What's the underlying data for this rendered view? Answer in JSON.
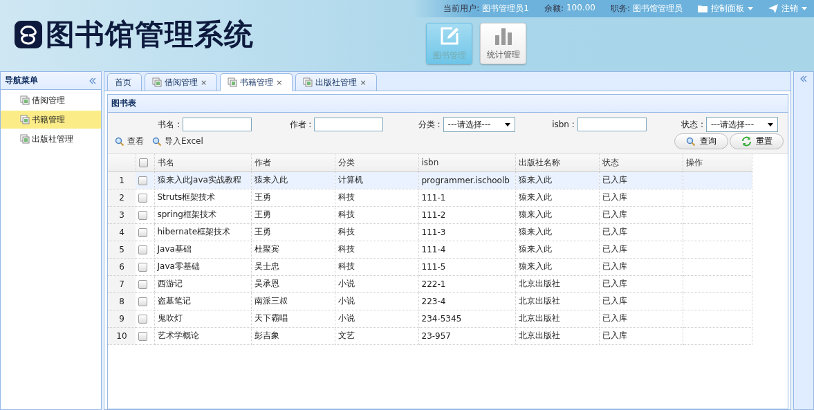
{
  "header": {
    "logo_text": "图书馆管理系统",
    "user_bar": [
      {
        "label": "当前用户:",
        "value": "图书管理员1"
      },
      {
        "label": "余额:",
        "value": "100.00"
      },
      {
        "label": "职务:",
        "value": "图书馆管理员"
      }
    ],
    "menus": [
      {
        "kind": "panel",
        "label": "控制面板"
      },
      {
        "kind": "logout",
        "label": "注销"
      }
    ],
    "modules": [
      {
        "kind": "edit",
        "label": "图书管理",
        "selected": true
      },
      {
        "kind": "chart",
        "label": "统计管理",
        "selected": false
      }
    ]
  },
  "sidebar": {
    "title": "导航菜单",
    "items": [
      {
        "label": "借阅管理",
        "selected": false
      },
      {
        "label": "书籍管理",
        "selected": true
      },
      {
        "label": "出版社管理",
        "selected": false
      }
    ]
  },
  "tabs": [
    {
      "label": "首页",
      "selected": false
    },
    {
      "label": "借阅管理",
      "selected": false,
      "close": "×"
    },
    {
      "label": "书籍管理",
      "selected": true,
      "close": "×"
    },
    {
      "label": "出版社管理",
      "selected": false,
      "close": "×"
    }
  ],
  "panel": {
    "title": "图书表",
    "filters": [
      {
        "kind": "input",
        "label": "书名 :"
      },
      {
        "kind": "input",
        "label": "作者 :"
      },
      {
        "kind": "select",
        "label": "分类 :",
        "value": "---请选择---"
      },
      {
        "kind": "input",
        "label": "isbn :"
      },
      {
        "kind": "select",
        "label": "状态 :",
        "value": "---请选择---"
      }
    ],
    "toolbar": [
      "查看",
      "导入Excel"
    ],
    "actions": [
      {
        "kind": "search",
        "label": "查询"
      },
      {
        "kind": "reset",
        "label": "重置"
      }
    ],
    "table": {
      "columns": [
        "书名",
        "作者",
        "分类",
        "isbn",
        "出版社名称",
        "状态",
        "操作"
      ],
      "header_checked": false,
      "rows": [
        {
          "num": "1",
          "selected": true,
          "checked": false,
          "cells": [
            "猿来入此Java实战教程",
            "猿来入此",
            "计算机",
            "programmer.ischoolb",
            "猿来入此",
            "已入库"
          ]
        },
        {
          "num": "2",
          "selected": false,
          "checked": false,
          "cells": [
            "Struts框架技术",
            "王勇",
            "科技",
            "111-1",
            "猿来入此",
            "已入库"
          ]
        },
        {
          "num": "3",
          "selected": false,
          "checked": false,
          "cells": [
            "spring框架技术",
            "王勇",
            "科技",
            "111-2",
            "猿来入此",
            "已入库"
          ]
        },
        {
          "num": "4",
          "selected": false,
          "checked": false,
          "cells": [
            "hibernate框架技术",
            "王勇",
            "科技",
            "111-3",
            "猿来入此",
            "已入库"
          ]
        },
        {
          "num": "5",
          "selected": false,
          "checked": false,
          "cells": [
            "Java基础",
            "杜聚宾",
            "科技",
            "111-4",
            "猿来入此",
            "已入库"
          ]
        },
        {
          "num": "6",
          "selected": false,
          "checked": false,
          "cells": [
            "Java零基础",
            "吴士忠",
            "科技",
            "111-5",
            "猿来入此",
            "已入库"
          ]
        },
        {
          "num": "7",
          "selected": false,
          "checked": false,
          "cells": [
            "西游记",
            "吴承恩",
            "小说",
            "222-1",
            "北京出版社",
            "已入库"
          ]
        },
        {
          "num": "8",
          "selected": false,
          "checked": false,
          "cells": [
            "盗墓笔记",
            "南派三叔",
            "小说",
            "223-4",
            "北京出版社",
            "已入库"
          ]
        },
        {
          "num": "9",
          "selected": false,
          "checked": false,
          "cells": [
            "鬼吹灯",
            "天下霸唱",
            "小说",
            "234-5345",
            "北京出版社",
            "已入库"
          ]
        },
        {
          "num": "10",
          "selected": false,
          "checked": false,
          "cells": [
            "艺术学概论",
            "彭吉象",
            "文艺",
            "23-957",
            "北京出版社",
            "已入库"
          ]
        }
      ]
    }
  }
}
